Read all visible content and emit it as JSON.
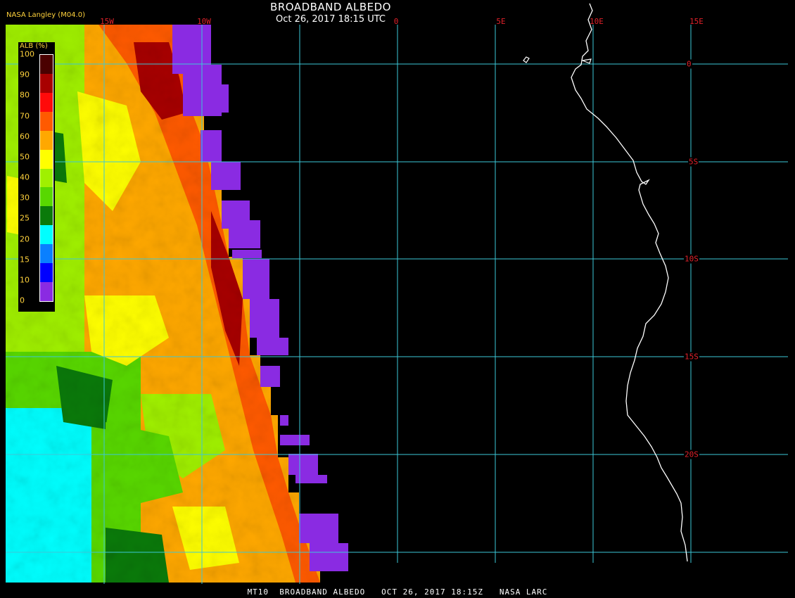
{
  "header": {
    "title": "BROADBAND ALBEDO",
    "subtitle": "Oct 26, 2017 18:15 UTC",
    "credit": "NASA Langley (M04.0)"
  },
  "footer": {
    "text": "MT10  BROADBAND ALBEDO   OCT 26, 2017 18:15Z   NASA LARC"
  },
  "grid": {
    "longitude_labels": [
      "15W",
      "10W",
      "0",
      "5E",
      "10E",
      "15E"
    ],
    "latitude_labels": [
      "0",
      "5S",
      "10S",
      "15S",
      "20S"
    ],
    "line_color": "#3cc8d8",
    "label_color": "#e0212a"
  },
  "legend": {
    "title": "ALB (%)",
    "ticks": [
      "100",
      "90",
      "80",
      "70",
      "60",
      "50",
      "40",
      "30",
      "25",
      "20",
      "15",
      "10",
      "0"
    ],
    "colors": [
      "#4a0000",
      "#a80000",
      "#ff0a0a",
      "#ff5a00",
      "#ffa800",
      "#ffff00",
      "#a0f000",
      "#58d800",
      "#0a7a0a",
      "#00ffff",
      "#0a80ff",
      "#0000ff",
      "#8a2be2"
    ]
  },
  "map_colors": {
    "background": "#000000",
    "coastline": "#ffffff",
    "no_data": "#8a2be2"
  }
}
